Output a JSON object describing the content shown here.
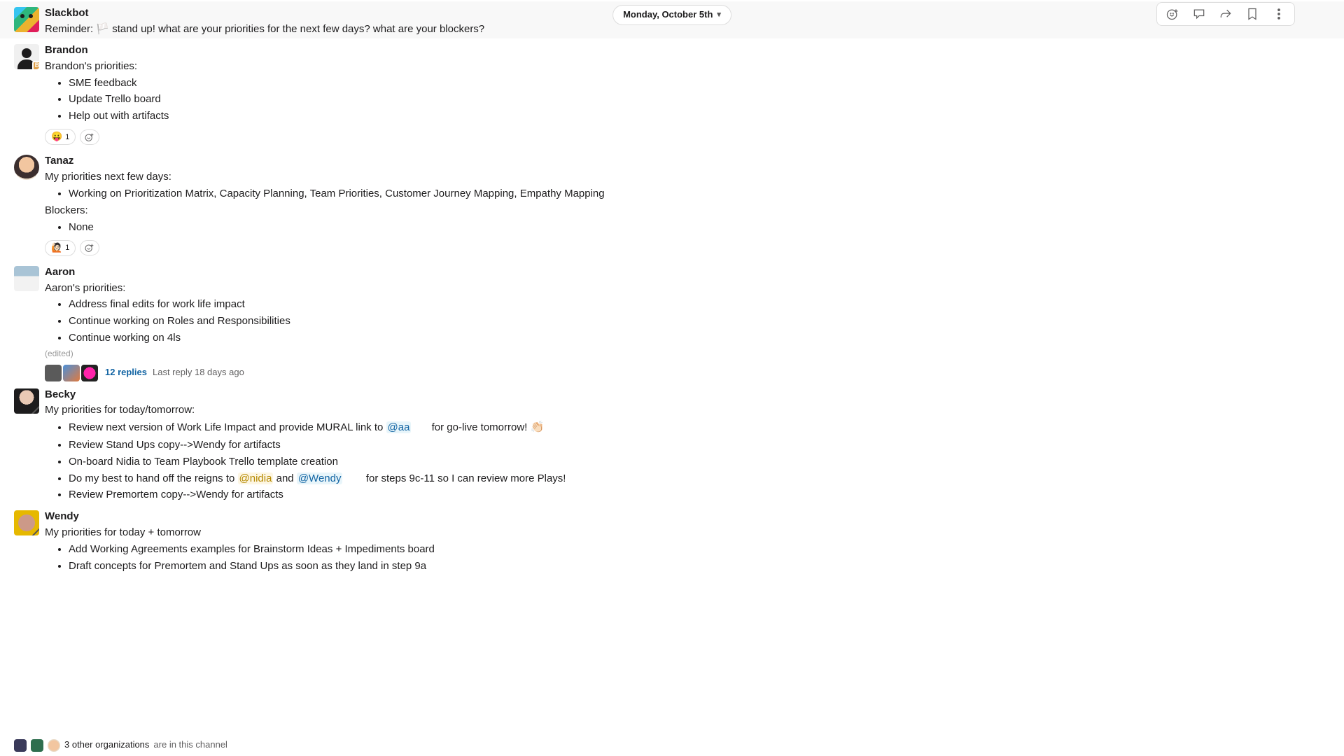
{
  "header": {
    "date_label": "Monday, October 5th"
  },
  "actions": {
    "react_tooltip": "Add reaction",
    "thread_tooltip": "Start thread",
    "share_tooltip": "Share message",
    "bookmark_tooltip": "Save",
    "more_tooltip": "More actions"
  },
  "messages": [
    {
      "author": "Slackbot",
      "avatar": "slackbot",
      "highlight": true,
      "text_prefix": "Reminder: ",
      "text_emoji": "🏳️",
      "text_main": " stand up! what are your priorities for the next few days? what are your blockers?"
    },
    {
      "author": "Brandon",
      "avatar": "brandon",
      "intro": "Brandon's priorities:",
      "bullets": [
        "SME feedback",
        "Update Trello board",
        "Help out with artifacts"
      ],
      "reactions": [
        {
          "emoji": "😛",
          "count": "1"
        }
      ]
    },
    {
      "author": "Tanaz",
      "avatar": "tanaz",
      "intro": "My priorities next few days:",
      "bullets": [
        "Working on Prioritization Matrix, Capacity Planning, Team Priorities, Customer Journey Mapping, Empathy Mapping"
      ],
      "second_label": "Blockers:",
      "bullets2": [
        "None"
      ],
      "reactions": [
        {
          "emoji": "🙋🏻",
          "count": "1"
        }
      ]
    },
    {
      "author": "Aaron",
      "avatar": "aaron",
      "intro": "Aaron's priorities:",
      "bullets": [
        "Address final edits for work life impact",
        "Continue working on Roles and Responsibilities",
        "Continue working on 4ls"
      ],
      "edited": "(edited)",
      "thread": {
        "replies_label": "12 replies",
        "meta": "Last reply 18 days ago"
      }
    },
    {
      "author": "Becky",
      "avatar": "becky",
      "intro": "My priorities for today/tomorrow:",
      "bullets_rich": [
        {
          "parts": [
            {
              "t": "Review next version of Work Life Impact and provide MURAL link to "
            },
            {
              "mention": "@aa",
              "cls": "mention"
            },
            {
              "t": "       for go-live tomorrow! "
            },
            {
              "emoji": "👏🏻"
            }
          ]
        },
        {
          "parts": [
            {
              "t": "Review Stand Ups copy-->Wendy for artifacts"
            }
          ]
        },
        {
          "parts": [
            {
              "t": "On-board Nidia to Team Playbook Trello template creation"
            }
          ]
        },
        {
          "parts": [
            {
              "t": "Do my best to hand off the reigns to "
            },
            {
              "mention": "@nidia",
              "cls": "mention ylw"
            },
            {
              "t": " and "
            },
            {
              "mention": "@Wendy",
              "cls": "mention"
            },
            {
              "t": "        for steps 9c-11 so I can review more Plays!"
            }
          ]
        },
        {
          "parts": [
            {
              "t": "Review Premortem copy-->Wendy for artifacts"
            }
          ]
        }
      ]
    },
    {
      "author": "Wendy",
      "avatar": "wendy",
      "intro": "My priorities for today + tomorrow",
      "bullets": [
        "Add Working Agreements examples for Brainstorm Ideas + Impediments board",
        "Draft concepts for Premortem and Stand Ups as soon as they land in step 9a"
      ]
    }
  ],
  "footer": {
    "strong": "3 other organizations",
    "rest": " are in this channel"
  }
}
